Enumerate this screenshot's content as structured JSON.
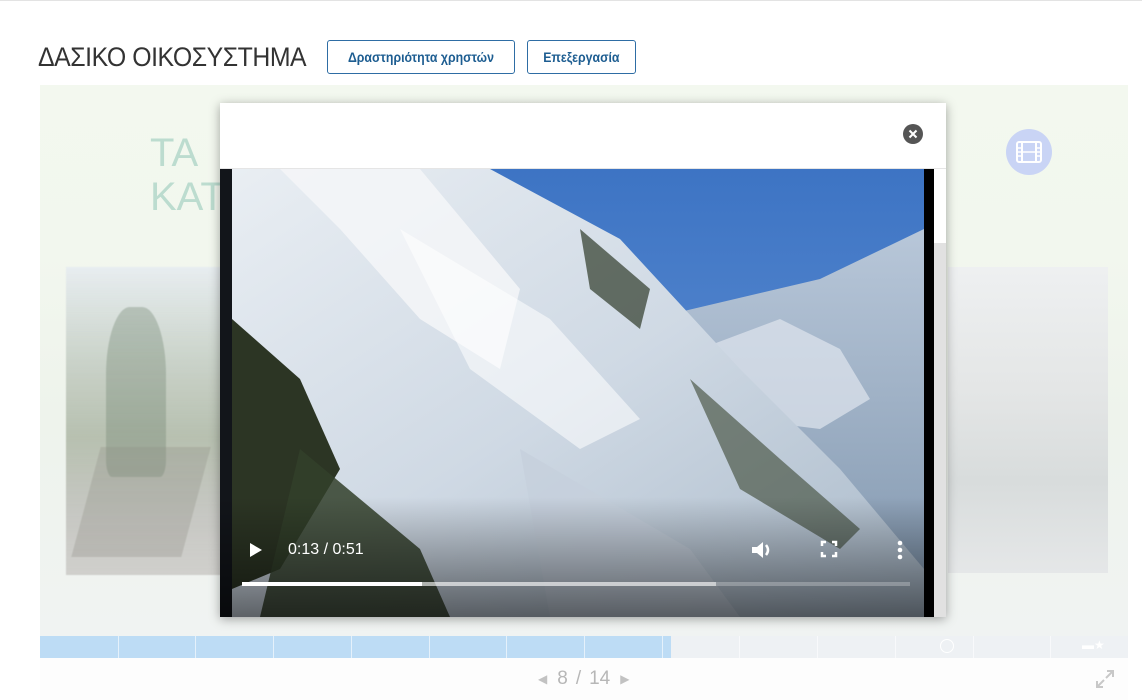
{
  "header": {
    "title": "ΔΑΣΙΚΟ ΟΙΚΟΣΥΣΤΗΜΑ",
    "activity_button": "Δραστηριότητα χρηστών",
    "edit_button": "Επεξεργασία"
  },
  "slide": {
    "heading_line1": "ΤΑ",
    "heading_line2": "ΚΑΤ",
    "video_icon": "film-icon"
  },
  "video": {
    "time": "0:13 / 0:51",
    "played_fraction": 0.27,
    "buffered_fraction": 0.71,
    "icons": [
      "play-icon",
      "volume-icon",
      "fullscreen-icon",
      "more-options-icon"
    ]
  },
  "modal": {
    "close_icon": "close-circle-icon"
  },
  "navigation": {
    "current": "8",
    "separator": "/",
    "total": "14",
    "progress_fraction": 0.58
  },
  "colors": {
    "button_border": "#2e6da4",
    "progress_fill": "#bddcf5",
    "film_circle": "#c9d4f5"
  }
}
